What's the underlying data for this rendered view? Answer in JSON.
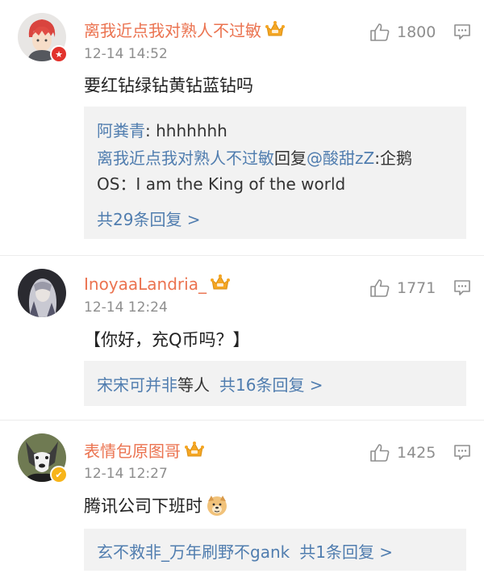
{
  "comments": [
    {
      "username": "离我近点我对熟人不过敏",
      "time": "12-14 14:52",
      "likes": "1800",
      "text": "要红钻绿钻黄钻蓝钻吗",
      "badge": "red-badge",
      "replies": {
        "line1_name": "阿粪青",
        "line1_sep": ": ",
        "line1_text": "hhhhhhh",
        "line2_name": "离我近点我对熟人不过敏",
        "line2_mid": "回复",
        "line2_mention": "@酸甜zZ",
        "line2_text": ":企鹅",
        "line3_text": "OS：I am the King of the world",
        "total": "共29条回复 >"
      }
    },
    {
      "username": "InoyaaLandria_",
      "time": "12-14 12:24",
      "likes": "1771",
      "text": "【你好，充Q币吗？】",
      "replies": {
        "people_name": "宋宋可并非",
        "people_suffix": "等人",
        "total": "共16条回复 >"
      }
    },
    {
      "username": "表情包原图哥",
      "time": "12-14 12:27",
      "likes": "1425",
      "text": "腾讯公司下班时",
      "badge": "yellow-badge",
      "emoji": "doge-emoji",
      "replies": {
        "people_name": "玄不救非_万年刷野不gank",
        "total": "共1条回复 >"
      }
    }
  ],
  "colors": {
    "username": "#eb7350",
    "link": "#507daf",
    "meta": "#8e8e8e",
    "reply_bg": "#f2f2f2",
    "crown": "#f5a623"
  }
}
